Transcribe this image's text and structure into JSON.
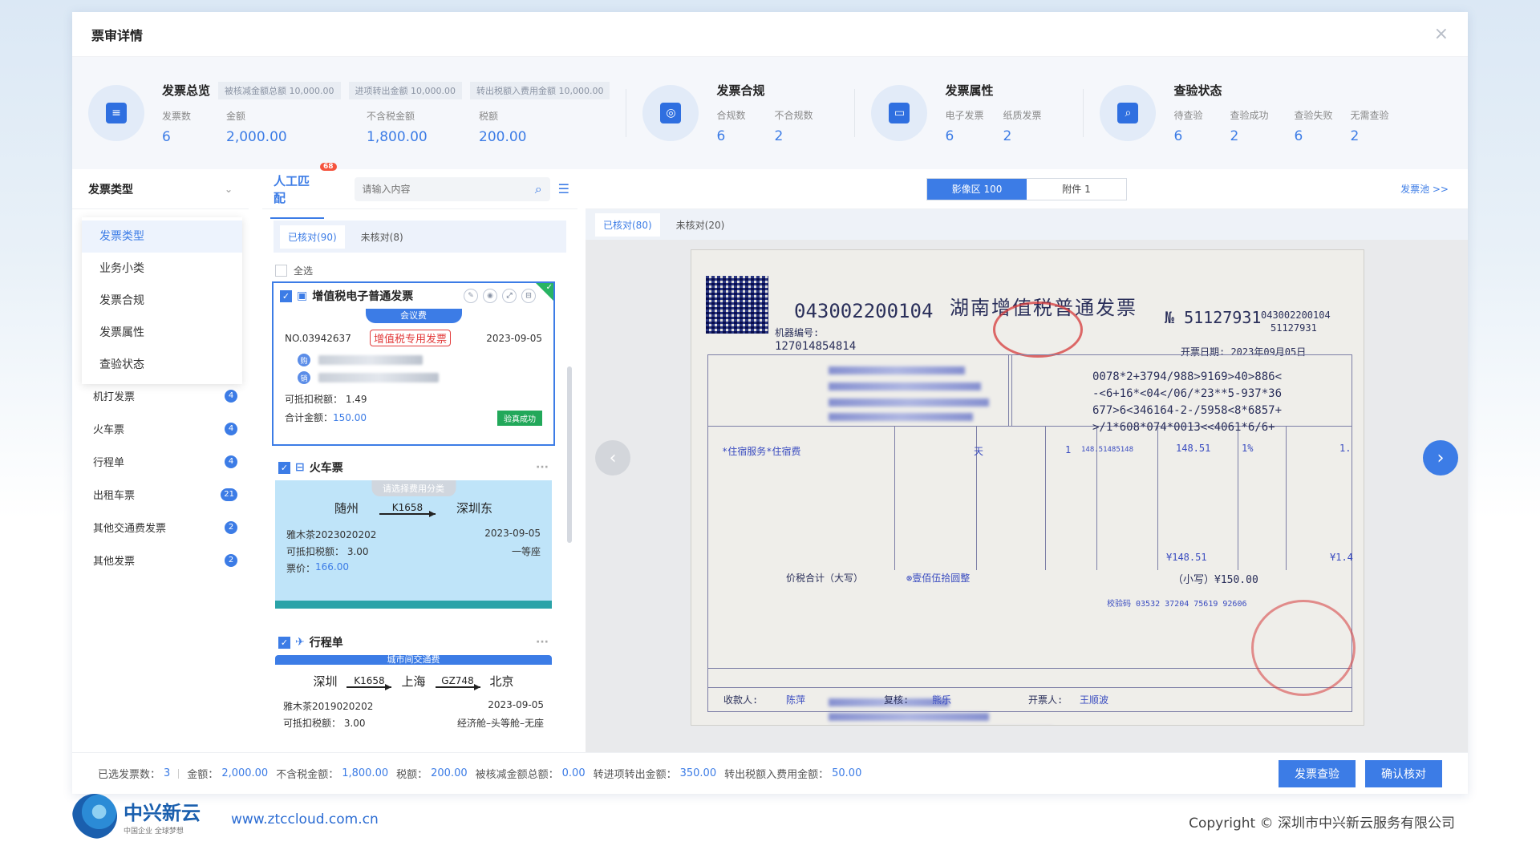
{
  "modal": {
    "title": "票审详情"
  },
  "summary": {
    "overview": {
      "title": "发票总览",
      "chips": [
        "被核减金额总额 10,000.00",
        "进项转出金额 10,000.00",
        "转出税额入费用金额 10,000.00"
      ],
      "stats": [
        {
          "label": "发票数",
          "value": "6"
        },
        {
          "label": "金额",
          "value": "2,000.00"
        },
        {
          "label": "不含税金额",
          "value": "1,800.00"
        },
        {
          "label": "税额",
          "value": "200.00"
        }
      ]
    },
    "compliance": {
      "title": "发票合规",
      "stats": [
        {
          "label": "合规数",
          "value": "6"
        },
        {
          "label": "不合规数",
          "value": "2"
        }
      ]
    },
    "attributes": {
      "title": "发票属性",
      "stats": [
        {
          "label": "电子发票",
          "value": "6"
        },
        {
          "label": "纸质发票",
          "value": "2"
        }
      ]
    },
    "verify": {
      "title": "查验状态",
      "stats": [
        {
          "label": "待查验",
          "value": "6"
        },
        {
          "label": "查验成功",
          "value": "2"
        },
        {
          "label": "查验失败",
          "value": "6"
        },
        {
          "label": "无需查验",
          "value": "2"
        }
      ]
    }
  },
  "left": {
    "select_label": "发票类型",
    "dropdown": [
      "发票类型",
      "业务小类",
      "发票合规",
      "发票属性",
      "查验状态"
    ],
    "items": [
      {
        "label": "机打发票",
        "count": "4"
      },
      {
        "label": "火车票",
        "count": "4"
      },
      {
        "label": "行程单",
        "count": "4"
      },
      {
        "label": "出租车票",
        "count": "21"
      },
      {
        "label": "其他交通费发票",
        "count": "2"
      },
      {
        "label": "其他发票",
        "count": "2"
      }
    ]
  },
  "middle": {
    "tab": "人工匹配",
    "tab_badge": "68",
    "search_placeholder": "请输入内容",
    "subtabs": [
      "已核对(90)",
      "未核对(8)"
    ],
    "select_all": "全选",
    "card1": {
      "type": "增值税电子普通发票",
      "tag": "会议费",
      "stamp": "增值税专用发票",
      "no": "NO.03942637",
      "date": "2023-09-05",
      "deductible": "可抵扣税额： 1.49",
      "total_label": "合计金额：",
      "total": "150.00",
      "status": "验真成功"
    },
    "card2": {
      "type": "火车票",
      "category": "请选择费用分类",
      "from": "随州",
      "train": "K1658",
      "to": "深圳东",
      "person": "雅木茶2023020202",
      "date": "2023-09-05",
      "deductible": "可抵扣税额： 3.00",
      "seat": "一等座",
      "price_label": "票价：",
      "price": "166.00"
    },
    "card3": {
      "type": "行程单",
      "category": "城市间交通费",
      "from": "深圳",
      "train1": "K1658",
      "via": "上海",
      "train2": "GZ748",
      "to": "北京",
      "person": "雅木茶2019020202",
      "date": "2023-09-05",
      "deductible": "可抵扣税额： 3.00",
      "seat": "经济舱–头等舱–无座"
    }
  },
  "right": {
    "seg": [
      "影像区 100",
      "附件 1"
    ],
    "pool": "发票池 >>",
    "subtabs": [
      "已核对(80)",
      "未核对(20)"
    ],
    "invoice": {
      "code": "043002200104",
      "title": "湖南增值税普通发票",
      "no_label": "№ 51127931",
      "code_right": "043002200104",
      "no_right": "51127931",
      "machine": "机器编号:",
      "machine_no": "127014854814",
      "date": "开票日期: 2023年09月05日",
      "cipher": [
        "0078*2+3794/988>9169>40>886<",
        "-<6+16*<04</06/*23**5-937*36",
        "677>6<346164-2-/5958<8*6857+",
        ">/1*608*074*0013<<4061*6/6+"
      ],
      "item": "*住宿服务*住宿费",
      "unit": "天",
      "qty": "1",
      "price": "148.51485148",
      "amount": "148.51",
      "rate": "1%",
      "tax": "1.",
      "sum_amount": "¥148.51",
      "sum_tax": "¥1.4",
      "total_words_label": "价税合计（大写）",
      "total_words": "⊗壹佰伍拾圆整",
      "total_small": "（小写）¥150.00",
      "check_code": "校验码 03532 37204 75619 92606",
      "payee_label": "收款人:",
      "payee": "陈萍",
      "reviewer_label": "复核:",
      "reviewer": "熊乐",
      "drawer_label": "开票人:",
      "drawer": "王顺波"
    }
  },
  "footer": {
    "selected_label": "已选发票数：",
    "selected": "3",
    "amount_label": "金额：",
    "amount": "2,000.00",
    "notax_label": "不含税金额：",
    "notax": "1,800.00",
    "tax_label": "税额：",
    "tax": "200.00",
    "reduced_label": "被核减金额总额：",
    "reduced": "0.00",
    "transfer_label": "转进项转出金额：",
    "transfer": "350.00",
    "taxfee_label": "转出税额入费用金额：",
    "taxfee": "50.00",
    "btn_verify": "发票查验",
    "btn_confirm": "确认核对"
  },
  "brand": {
    "name": "中兴新云",
    "slogan": "中国企业 全球梦想",
    "site": "www.ztccloud.com.cn",
    "copyright": "Copyright © 深圳市中兴新云服务有限公司"
  },
  "colors": {
    "accent": "#3c7ce6",
    "success": "#22a85a",
    "danger": "#e23b3b"
  }
}
